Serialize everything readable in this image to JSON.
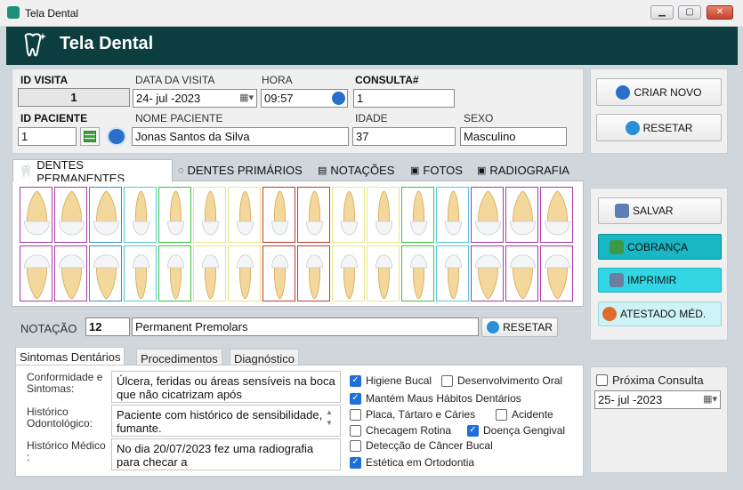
{
  "window": {
    "title": "Tela Dental",
    "minimize": "▁",
    "maximize": "▢",
    "close": "✕"
  },
  "header": {
    "title": "Tela Dental"
  },
  "visit": {
    "id_visita_label": "ID VISITA",
    "id_visita_value": "1",
    "data_label": "DATA DA VISITA",
    "data_value": "24- jul -2023",
    "hora_label": "HORA",
    "hora_value": "09:57",
    "consulta_label": "CONSULTA#",
    "consulta_value": "1",
    "id_paciente_label": "ID PACIENTE",
    "id_paciente_value": "1",
    "nome_label": "NOME PACIENTE",
    "nome_value": "Jonas Santos da Silva",
    "idade_label": "IDADE",
    "idade_value": "37",
    "sexo_label": "SEXO",
    "sexo_value": "Masculino"
  },
  "actions": {
    "criar_novo": "CRIAR NOVO",
    "resetar": "RESETAR"
  },
  "tabs": [
    {
      "label": "DENTES PERMANENTES"
    },
    {
      "label": "DENTES PRIMÁRIOS"
    },
    {
      "label": "NOTAÇÕES"
    },
    {
      "label": "FOTOS"
    },
    {
      "label": "RADIOGRAFIA"
    }
  ],
  "teeth_upper_colors": [
    "#a93aa9",
    "#a93aa9",
    "#3b8fd9",
    "#55c7e0",
    "#3ac43a",
    "#e6e68a",
    "#e6e68a",
    "#c0392b",
    "#c0392b",
    "#e6e68a",
    "#e6e68a",
    "#3ac43a",
    "#55c7e0",
    "#a93aa9",
    "#a93aa9",
    "#a93aa9"
  ],
  "teeth_lower_colors": [
    "#a93aa9",
    "#a93aa9",
    "#3b8fd9",
    "#55c7e0",
    "#3ac43a",
    "#e6e68a",
    "#e6e68a",
    "#c0392b",
    "#c0392b",
    "#e6e68a",
    "#e6e68a",
    "#3ac43a",
    "#55c7e0",
    "#a93aa9",
    "#a93aa9",
    "#a93aa9"
  ],
  "right_actions": {
    "salvar": "SALVAR",
    "cobranca": "COBRANÇA",
    "imprimir": "IMPRIMIR",
    "atestado": "ATESTADO MÉD."
  },
  "notation": {
    "label": "NOTAÇÃO",
    "code": "12",
    "name": "Permanent Premolars",
    "reset": "RESETAR"
  },
  "subtabs": [
    {
      "label": "Sintomas Dentários"
    },
    {
      "label": "Procedimentos"
    },
    {
      "label": "Diagnóstico"
    }
  ],
  "symptoms": {
    "conformidade_label": "Conformidade e Sintomas:",
    "conformidade_text": "Úlcera, feridas ou áreas sensíveis na boca que não cicatrizam após",
    "historico_odonto_label": "Histórico Odontológico:",
    "historico_odonto_text": "Paciente com histórico de sensibilidade, fumante.",
    "historico_medico_label": "Histórico Médico :",
    "historico_medico_text": "No dia 20/07/2023 fez uma radiografia para checar a"
  },
  "checks": [
    {
      "label": "Higiene Bucal",
      "checked": "yes"
    },
    {
      "label": "Desenvolvimento Oral",
      "checked": "no"
    },
    {
      "label": "Mantém Maus Hábitos Dentários",
      "checked": "yes"
    },
    {
      "label": "Placa, Tártaro e Cáries",
      "checked": "no"
    },
    {
      "label": "Acidente",
      "checked": "no"
    },
    {
      "label": "Checagem Rotina",
      "checked": "no"
    },
    {
      "label": "Doença Gengival",
      "checked": "yes"
    },
    {
      "label": "Detecção de Câncer Bucal",
      "checked": "no"
    },
    {
      "label": "Estética em Ortodontia",
      "checked": "yes"
    }
  ],
  "next": {
    "label": "Próxima Consulta",
    "date": "25- jul -2023"
  }
}
